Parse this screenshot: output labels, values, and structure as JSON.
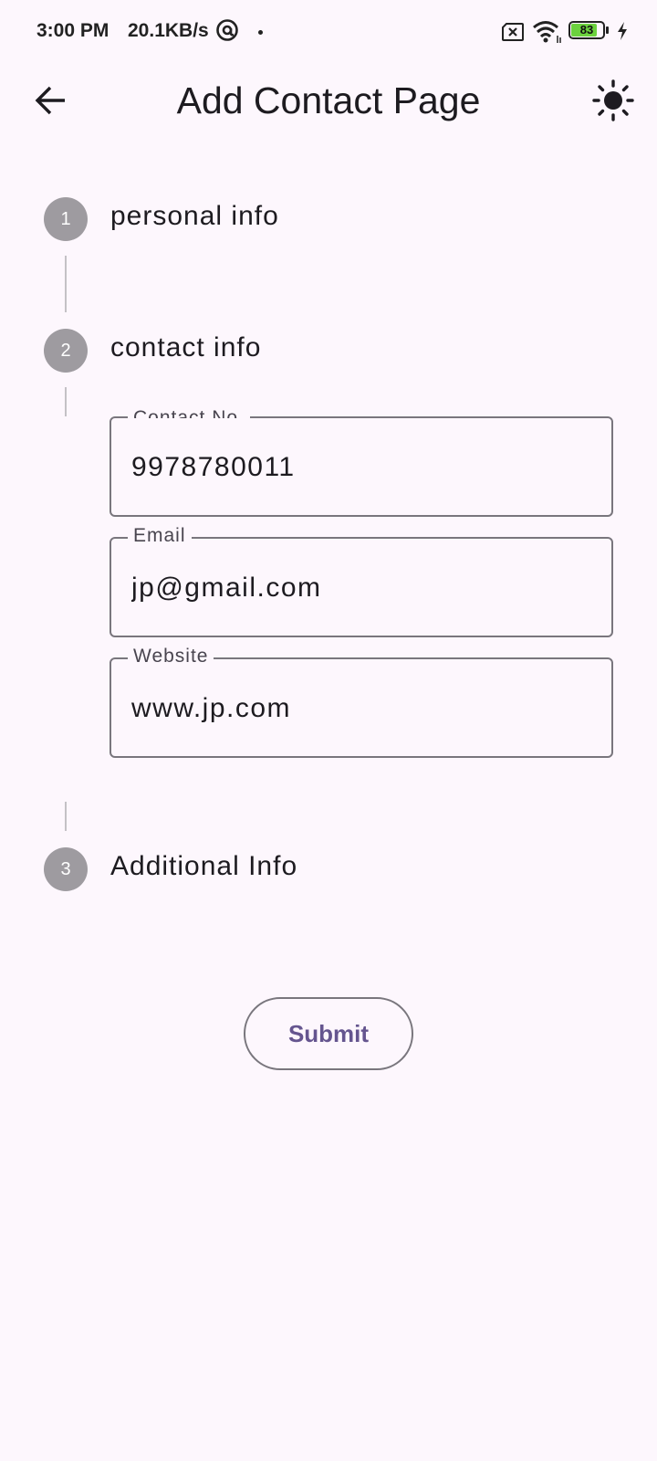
{
  "status_bar": {
    "time": "3:00 PM",
    "network_speed": "20.1KB/s",
    "battery_level": "83",
    "battery_fraction": 0.83,
    "icons": [
      "at-sign-icon",
      "notification-dot-icon",
      "sim-disabled-icon",
      "wifi-icon",
      "battery-icon",
      "charging-bolt-icon"
    ]
  },
  "app_bar": {
    "title": "Add Contact Page",
    "back_icon": "arrow-back-icon",
    "theme_icon": "sun-icon"
  },
  "stepper": {
    "steps": [
      {
        "number": "1",
        "title": "personal info"
      },
      {
        "number": "2",
        "title": "contact info"
      },
      {
        "number": "3",
        "title": "Additional Info"
      }
    ],
    "active_step": 2
  },
  "fields": {
    "contact": {
      "label": "Contact No.",
      "value": "9978780011"
    },
    "email": {
      "label": "Email",
      "value": "jp@gmail.com"
    },
    "website": {
      "label": "Website",
      "value": "www.jp.com"
    }
  },
  "submit_label": "Submit",
  "colors": {
    "background": "#fdf7fd",
    "step_circle": "#9e9ba0",
    "submit_text": "#65558f",
    "field_border": "#79767d"
  }
}
